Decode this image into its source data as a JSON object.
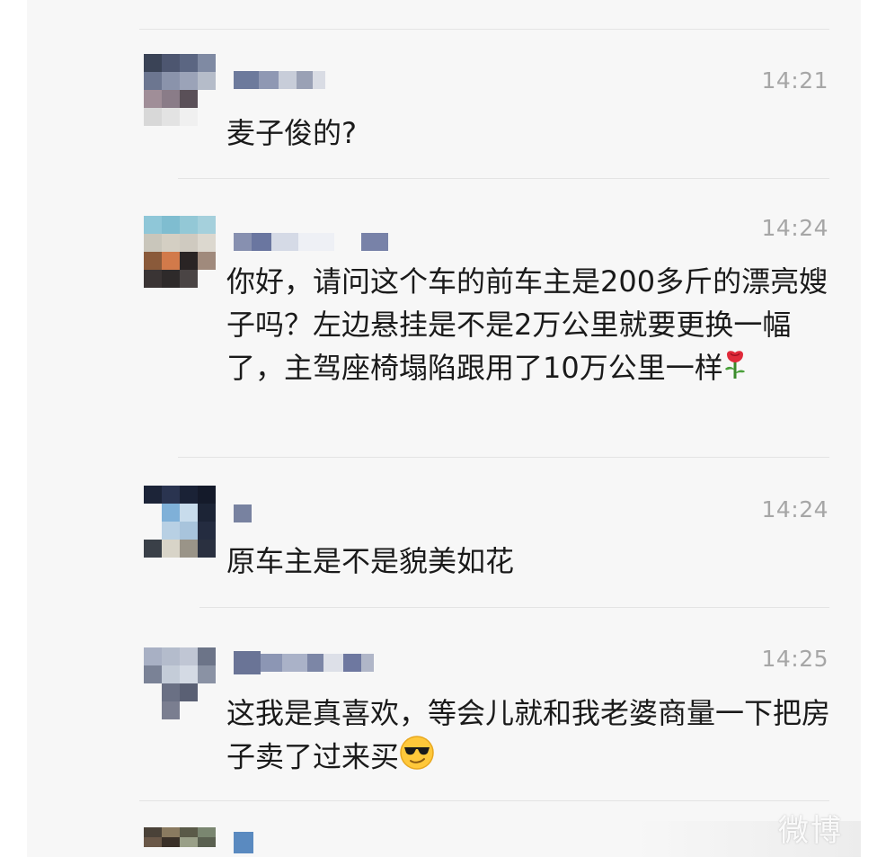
{
  "messages": [
    {
      "time": "14:21",
      "text": "麦子俊的?"
    },
    {
      "time": "14:24",
      "text": "你好，请问这个车的前车主是200多斤的漂亮嫂子吗？左边悬挂是不是2万公里就要更换一幅了，主驾座椅塌陷跟用了10万公里一样",
      "emoji": "rose-icon"
    },
    {
      "time": "14:24",
      "text": "原车主是不是貌美如花"
    },
    {
      "time": "14:25",
      "text": "这我是真喜欢，等会儿就和我老婆商量一下把房子卖了过来买",
      "emoji": "cool-sunglasses-icon"
    }
  ],
  "watermark": "微博",
  "colors": {
    "background": "#f7f7f7",
    "time": "#a6a6a6",
    "text": "#1a1a1a",
    "divider": "#e4e4e4"
  }
}
